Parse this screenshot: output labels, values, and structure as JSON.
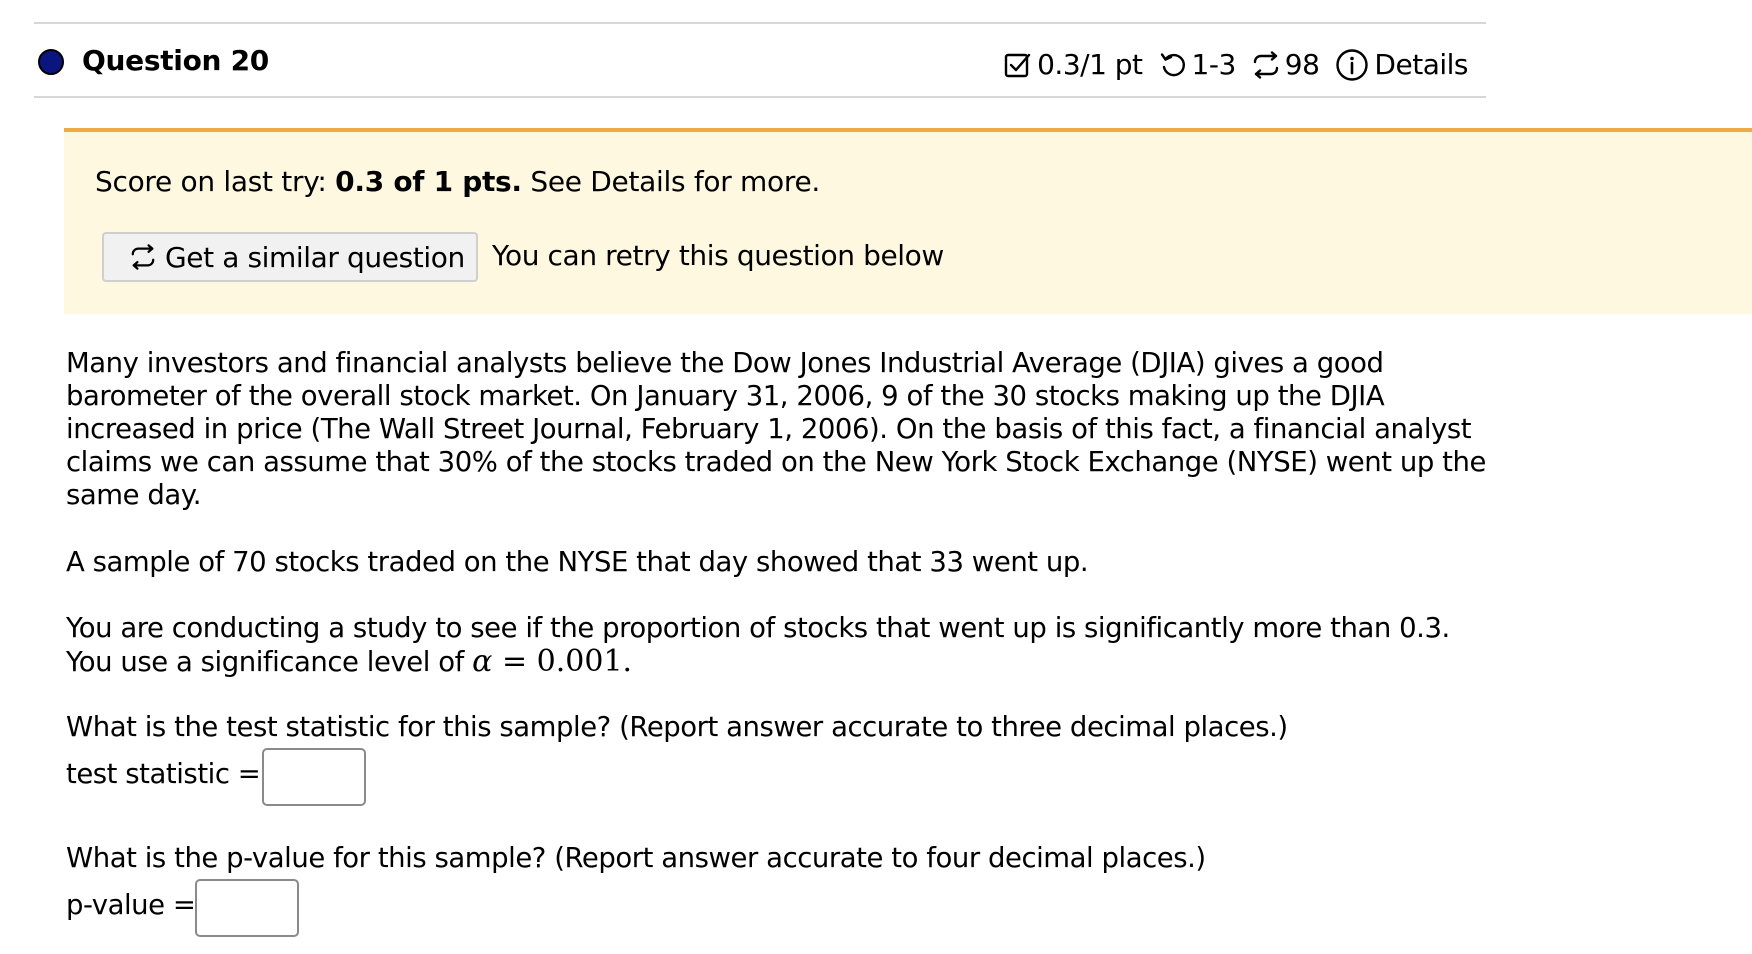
{
  "header": {
    "question_title": "Question 20",
    "score": "0.3/1 pt",
    "attempts": "1-3",
    "similar_count": "98",
    "details_label": "Details"
  },
  "banner": {
    "score_prefix": "Score on last try:",
    "score_value": "0.3 of 1 pts.",
    "score_suffix": "See Details for more.",
    "similar_button_label": "Get a similar question",
    "retry_note": "You can retry this question below"
  },
  "problem": {
    "para1_line1": "Many investors and financial analysts believe the Dow Jones Industrial Average (DJIA) gives a good",
    "para1_line2": "barometer of the overall stock market. On January 31, 2006, 9 of the 30 stocks making up the DJIA",
    "para1_line3": "increased in price (The Wall Street Journal, February 1, 2006). On the basis of this fact, a financial analyst",
    "para1_line4": "claims we can assume that 30% of the stocks traded on the New York Stock Exchange (NYSE) went up the",
    "para1_line5": "same day.",
    "sample": "A sample of 70 stocks traded on the NYSE that day showed that 33 went up.",
    "study_line1": "You are conducting a study to see if the proportion of stocks that went up is significantly more than 0.3.",
    "study_line2_prefix": "You use a significance level of",
    "alpha_symbol": "α",
    "alpha_equals": "=",
    "alpha_value": "0.001."
  },
  "questions": {
    "q1_text": "What is the test statistic for this sample? (Report answer accurate to three decimal places.)",
    "q1_label": "test statistic =",
    "q1_value": "",
    "q2_text": "What is the p-value for this sample? (Report answer accurate to four decimal places.)",
    "q2_label": "p-value =",
    "q2_value": ""
  },
  "colors": {
    "question_dot": "#0a1580",
    "banner_background": "#fff8e1",
    "banner_border": "#efa945"
  },
  "icons": [
    "checkbox-icon",
    "retry-icon",
    "similar-question-icon",
    "info-icon"
  ]
}
